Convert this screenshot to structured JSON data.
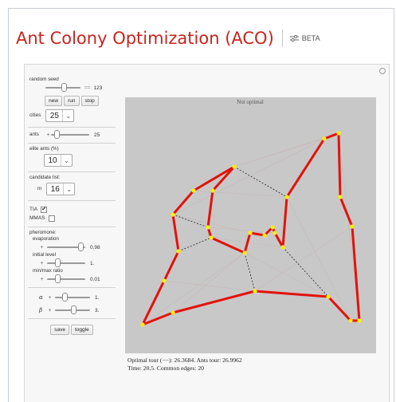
{
  "header": {
    "title": "Ant Colony Optimization (ACO)",
    "badge": "BETA"
  },
  "controls": {
    "random_seed": {
      "label": "random seed",
      "value": "123",
      "fraction": 0.55
    },
    "buttons": {
      "new": "new",
      "run": "run",
      "stop": "stop"
    },
    "cities": {
      "label": "cities",
      "value": "25"
    },
    "ants": {
      "label": "ants",
      "value": "25",
      "fraction": 0.1
    },
    "elite_ants": {
      "label": "elite ants (%)",
      "value": "10"
    },
    "candidate_list": {
      "label": "candidate list:",
      "m_label": "m",
      "value": "16"
    },
    "tia": {
      "label": "TIA",
      "checked": true,
      "mark": "✔"
    },
    "mmas": {
      "label": "MMAS",
      "checked": false
    },
    "pheromone": {
      "label": "pheromone:",
      "evaporation": {
        "label": "evaporation",
        "value": "0.98",
        "fraction": 0.95
      },
      "initial_level": {
        "label": "initial level",
        "value": "1.",
        "fraction": 0.25
      },
      "min_max_ratio": {
        "label": "min/max ratio",
        "value": "0.01",
        "fraction": 0.25
      }
    },
    "alpha": {
      "symbol": "α",
      "value": "1.",
      "fraction": 0.25
    },
    "beta": {
      "symbol": "β",
      "value": "3.",
      "fraction": 0.55
    },
    "bottom_buttons": {
      "save": "save",
      "toggle": "toggle"
    }
  },
  "plot": {
    "label": "Not optimal",
    "tour_color": "#e3120b",
    "node_color": "#ffee00",
    "background": "#c8c8c8"
  },
  "info": {
    "line1": "Optimal tour (−−): 26.3684. Ants tour: 26.9962",
    "line2": "Time: 20.5. Common edges: 20"
  }
}
